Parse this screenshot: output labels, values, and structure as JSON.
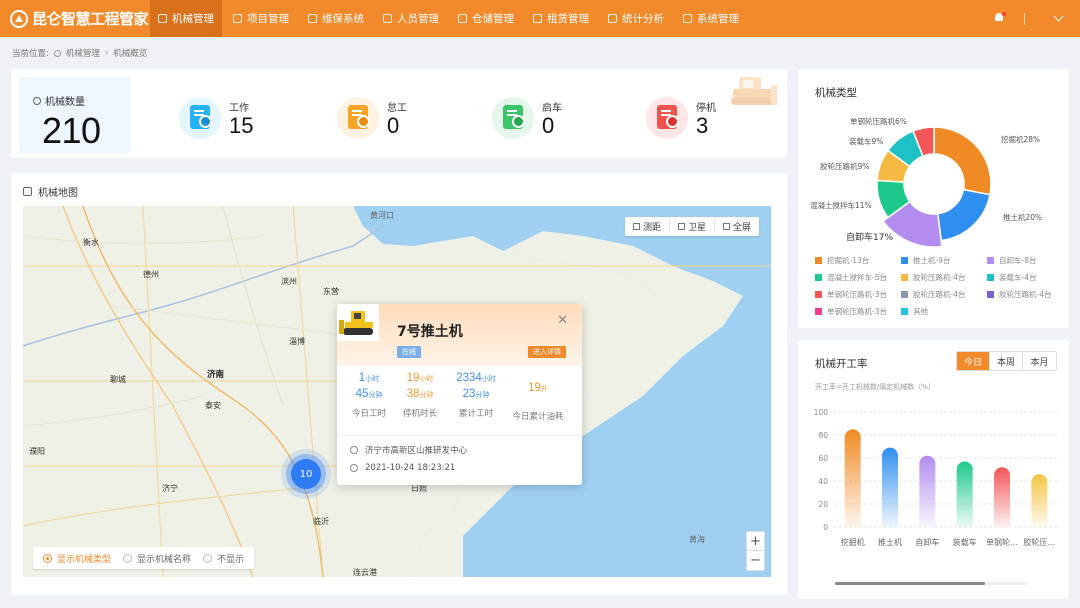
{
  "app": {
    "title": "昆仑智慧工程管家"
  },
  "nav": {
    "items": [
      {
        "label": "机械管理",
        "icon": "gear-icon"
      },
      {
        "label": "项目管理",
        "icon": "briefcase-icon"
      },
      {
        "label": "维保系统",
        "icon": "tools-icon"
      },
      {
        "label": "人员管理",
        "icon": "user-icon"
      },
      {
        "label": "仓储管理",
        "icon": "warehouse-icon"
      },
      {
        "label": "租赁管理",
        "icon": "lease-icon"
      },
      {
        "label": "统计分析",
        "icon": "chart-icon"
      },
      {
        "label": "系统管理",
        "icon": "settings-icon"
      }
    ],
    "active": "机械管理"
  },
  "breadcrumb": {
    "prefix": "当前位置:",
    "level1": "机械管理",
    "level2": "机械概览"
  },
  "stats": {
    "count_label": "机械数量",
    "count_value": "210",
    "items": [
      {
        "name": "工作",
        "value": "15",
        "color": "#26b3f5"
      },
      {
        "name": "怠工",
        "value": "0",
        "color": "#f7a326"
      },
      {
        "name": "启车",
        "value": "0",
        "color": "#3cc46a"
      },
      {
        "name": "停机",
        "value": "3",
        "color": "#f0524d"
      }
    ]
  },
  "map": {
    "title": "机械地图",
    "tools": {
      "measure": "测距",
      "satellite": "卫星",
      "fullscreen": "全屏"
    },
    "labels": {
      "huanghekou": "黄河口",
      "hengshui": "衡水",
      "dezhou": "德州",
      "binzhou": "滨州",
      "dongying": "东营",
      "zibo": "淄博",
      "weifang": "潍坊",
      "liaocheng": "聊城",
      "jinan": "济南",
      "taian": "泰安",
      "puyang": "濮阳",
      "jining": "济宁",
      "linyi": "临沂",
      "rizhao": "日照",
      "lianyungang": "连云港",
      "huanghai": "黄海"
    },
    "cluster_count": "10",
    "display_options": [
      "显示机械类型",
      "显示机械名称",
      "不显示"
    ],
    "selected_option": "显示机械类型",
    "popup": {
      "name": "7号推土机",
      "status": "在线",
      "detail_button": "进入详情",
      "today_work": {
        "h": "1",
        "h_unit": "小时",
        "m": "45",
        "m_unit": "分钟",
        "caption": "今日工时"
      },
      "stop_time": {
        "h": "19",
        "h_unit": "小时",
        "m": "38",
        "m_unit": "分钟",
        "caption": "停机时长"
      },
      "total_work": {
        "h": "2334",
        "h_unit": "小时",
        "m": "23",
        "m_unit": "分钟",
        "caption": "累计工时"
      },
      "fuel": {
        "v": "19",
        "unit": "升",
        "caption": "今日累计油耗"
      },
      "address": "济宁市高新区山推研发中心",
      "time": "2021-10-24 18:23:21"
    }
  },
  "machine_types": {
    "title": "机械类型",
    "slice_labels": [
      "挖掘机28%",
      "推土机20%",
      "自卸车17%",
      "混凝土搅拌车11%",
      "胶轮压路机9%",
      "装载车9%",
      "单钢轮压路机6%"
    ],
    "legend": [
      {
        "label": "挖掘机-13台",
        "color": "#f08a24"
      },
      {
        "label": "推土机-9台",
        "color": "#2f8ff0"
      },
      {
        "label": "自卸车-8台",
        "color": "#b48cf0"
      },
      {
        "label": "混凝土搅拌车-5台",
        "color": "#1dc98a"
      },
      {
        "label": "胶轮压路机-4台",
        "color": "#f5b843"
      },
      {
        "label": "装载车-4台",
        "color": "#1ec2c4"
      },
      {
        "label": "单钢轮压路机-3台",
        "color": "#f25656"
      },
      {
        "label": "胶轮压路机-4台",
        "color": "#8e99ab"
      },
      {
        "label": "胶轮压路机-4台",
        "color": "#7c5fd1"
      },
      {
        "label": "单钢轮压路机-3台",
        "color": "#f03c8c"
      },
      {
        "label": "其他",
        "color": "#22c6e0"
      }
    ]
  },
  "chart_data": [
    {
      "type": "pie",
      "title": "机械类型",
      "categories": [
        "挖掘机",
        "推土机",
        "自卸车",
        "混凝土搅拌车",
        "胶轮压路机",
        "装载车",
        "单钢轮压路机"
      ],
      "values": [
        28,
        20,
        17,
        11,
        9,
        9,
        6
      ],
      "colors": [
        "#f08a24",
        "#2f8ff0",
        "#b48cf0",
        "#1dc98a",
        "#f5b843",
        "#1ec2c4",
        "#f25656"
      ]
    },
    {
      "type": "bar",
      "title": "机械开工率",
      "note": "开工率=开工机械数/填定机械数（%）",
      "categories": [
        "挖掘机",
        "推土机",
        "自卸车",
        "装载车",
        "单钢轮…",
        "胶轮压…"
      ],
      "values": [
        85,
        69,
        62,
        57,
        52,
        46
      ],
      "yticks": [
        "0",
        "20",
        "40",
        "60",
        "80",
        "100"
      ],
      "ylim": [
        0,
        100
      ],
      "colors": [
        "#f08a24",
        "#2f8ff0",
        "#b48cf0",
        "#1dc98a",
        "#f25656",
        "#f5c443"
      ]
    }
  ],
  "rate": {
    "title": "机械开工率",
    "tabs": [
      "今日",
      "本周",
      "本月"
    ],
    "active_tab": "今日"
  }
}
